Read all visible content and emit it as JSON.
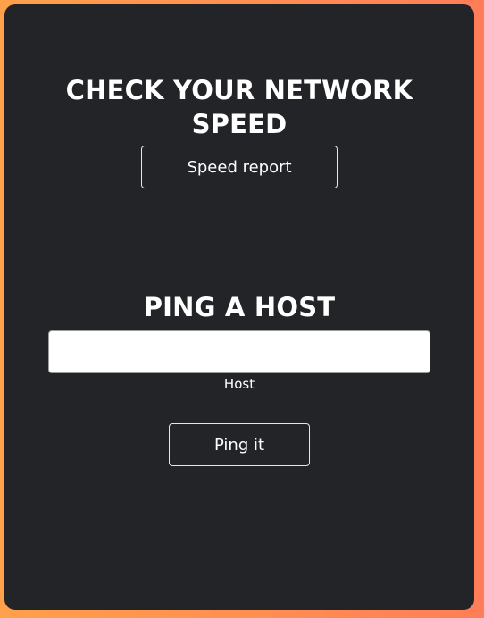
{
  "speed_section": {
    "title": "CHECK YOUR NETWORK SPEED",
    "button_label": "Speed report"
  },
  "ping_section": {
    "title": "PING A HOST",
    "host_input": {
      "value": "",
      "placeholder": ""
    },
    "host_label": "Host",
    "button_label": "Ping it"
  },
  "colors": {
    "background_gradient_start": "#ffa04a",
    "background_gradient_end": "#ff7d58",
    "card_background": "#222428",
    "text": "#ffffff",
    "input_background": "#ffffff"
  }
}
